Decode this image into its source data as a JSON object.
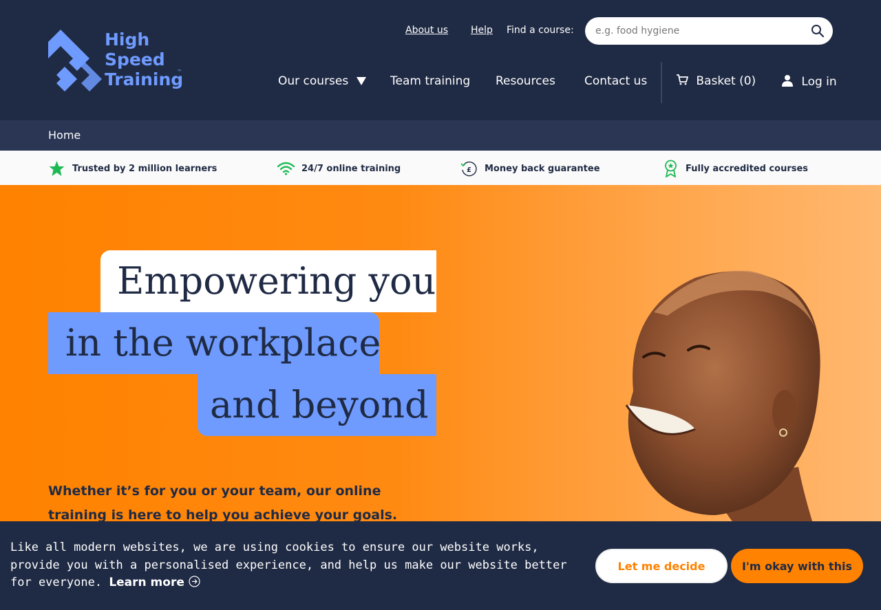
{
  "brand": {
    "logo_lines": [
      "High",
      "Speed",
      "Training"
    ],
    "trademark": "™",
    "accent_color": "#6f9bff",
    "header_bg": "#1f2a44",
    "orange": "#ff8200"
  },
  "top_links": {
    "about": "About us",
    "help": "Help",
    "find_label": "Find a course:"
  },
  "search": {
    "placeholder": "e.g. food hygiene",
    "icon": "search-icon"
  },
  "nav": {
    "courses": "Our courses",
    "team": "Team training",
    "resources": "Resources",
    "contact": "Contact us",
    "basket": "Basket (0)",
    "login": "Log in"
  },
  "breadcrumb": {
    "home": "Home"
  },
  "trust": [
    {
      "label": "Trusted by 2 million learners",
      "icon": "star-icon"
    },
    {
      "label": "24/7 online training",
      "icon": "wifi-icon"
    },
    {
      "label": "Money back guarantee",
      "icon": "money-back-icon"
    },
    {
      "label": "Fully accredited courses",
      "icon": "award-icon"
    }
  ],
  "hero": {
    "line1": "Empowering you",
    "line2": "in the workplace",
    "line3": "and beyond",
    "subtitle": "Whether it’s for you or your team, our online training is here to help you achieve your goals."
  },
  "cookie": {
    "text": "Like all modern websites, we are using cookies to ensure our website works, provide you with a personalised experience, and help us make our website better for everyone.",
    "learn_more": "Learn more",
    "decide": "Let me decide",
    "ok": "I'm okay with this"
  }
}
